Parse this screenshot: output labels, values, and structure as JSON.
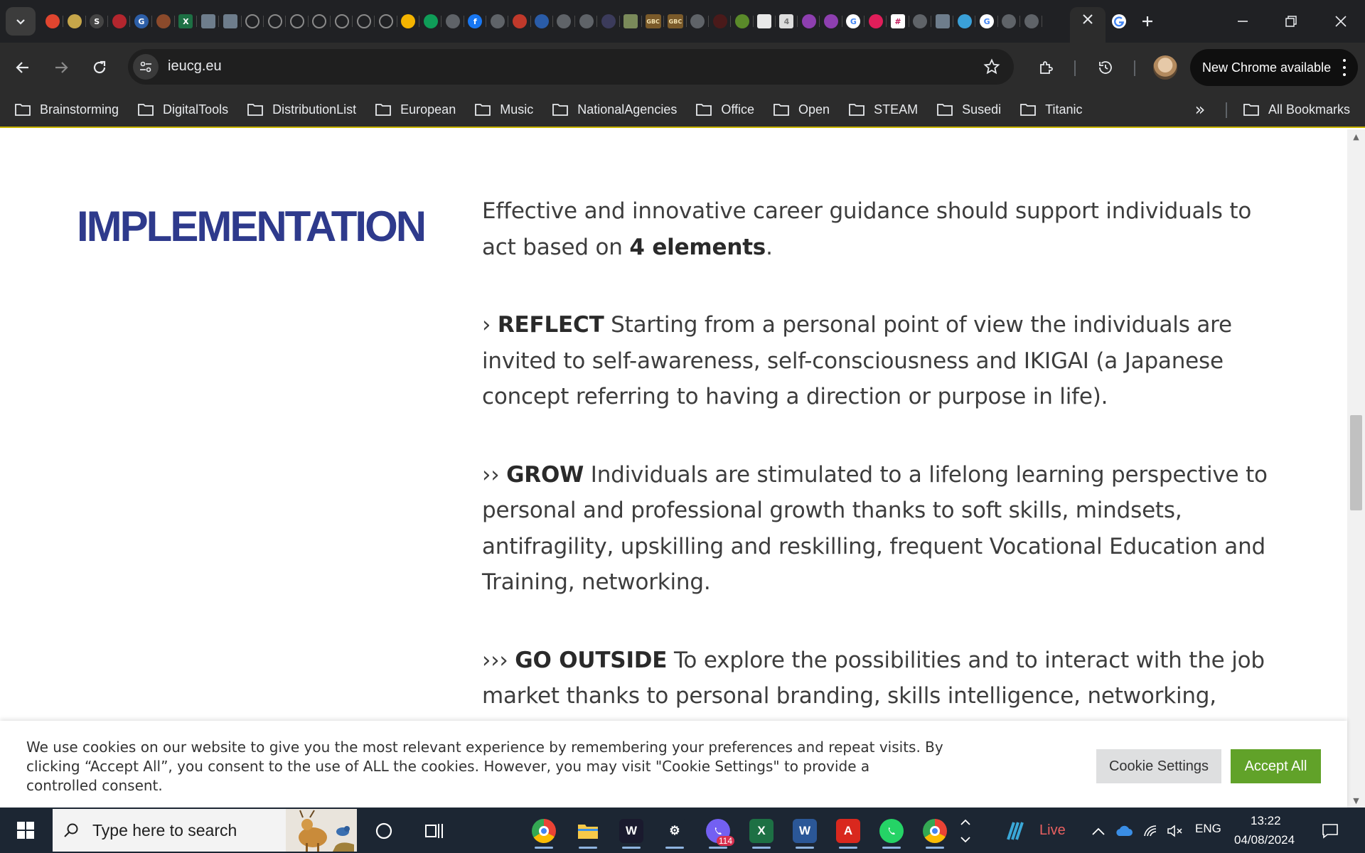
{
  "browser": {
    "active_tab_favicon": "google-icon",
    "url": "ieucg.eu",
    "update_label": "New Chrome available",
    "colors": {
      "tabstrip": "#202124",
      "toolbar": "#2c2c2c",
      "accent_border": "#c8b400"
    }
  },
  "tabs": [
    {
      "icon": "tab-favicon-red-circle",
      "color": "#e0452f",
      "glyph": ""
    },
    {
      "icon": "tab-favicon-colorful",
      "color": "#c6a64a",
      "glyph": ""
    },
    {
      "icon": "tab-favicon-s",
      "color": "#444444",
      "glyph": "S"
    },
    {
      "icon": "tab-favicon-red-logo",
      "color": "#b3262e",
      "glyph": ""
    },
    {
      "icon": "tab-favicon-g-blue",
      "color": "#2d5fa8",
      "glyph": "G"
    },
    {
      "icon": "tab-favicon-brown",
      "color": "#8b4a2b",
      "glyph": ""
    },
    {
      "icon": "tab-favicon-excel",
      "color": "#1d7044",
      "glyph": "X"
    },
    {
      "icon": "tab-favicon-photo",
      "color": "#6e7d8c",
      "glyph": ""
    },
    {
      "icon": "tab-favicon-photo",
      "color": "#6e7d8c",
      "glyph": ""
    },
    {
      "icon": "tab-favicon-loading",
      "color": "",
      "glyph": ""
    },
    {
      "icon": "tab-favicon-loading",
      "color": "",
      "glyph": ""
    },
    {
      "icon": "tab-favicon-loading",
      "color": "",
      "glyph": ""
    },
    {
      "icon": "tab-favicon-loading",
      "color": "",
      "glyph": ""
    },
    {
      "icon": "tab-favicon-loading",
      "color": "",
      "glyph": ""
    },
    {
      "icon": "tab-favicon-loading",
      "color": "",
      "glyph": ""
    },
    {
      "icon": "tab-favicon-loading",
      "color": "",
      "glyph": ""
    },
    {
      "icon": "tab-favicon-drive",
      "color": "#f4b400",
      "glyph": ""
    },
    {
      "icon": "tab-favicon-drive",
      "color": "#0f9d58",
      "glyph": ""
    },
    {
      "icon": "tab-favicon-globe",
      "color": "#5f6368",
      "glyph": ""
    },
    {
      "icon": "tab-favicon-facebook",
      "color": "#1877f2",
      "glyph": "f"
    },
    {
      "icon": "tab-favicon-globe",
      "color": "#5f6368",
      "glyph": ""
    },
    {
      "icon": "tab-favicon-red-white",
      "color": "#c0392b",
      "glyph": ""
    },
    {
      "icon": "tab-favicon-blue-circle",
      "color": "#2a5ca8",
      "glyph": ""
    },
    {
      "icon": "tab-favicon-globe",
      "color": "#5f6368",
      "glyph": ""
    },
    {
      "icon": "tab-favicon-globe",
      "color": "#5f6368",
      "glyph": ""
    },
    {
      "icon": "tab-favicon-dark",
      "color": "#3b3b5b",
      "glyph": ""
    },
    {
      "icon": "tab-favicon-photo",
      "color": "#7a8a5a",
      "glyph": ""
    },
    {
      "icon": "tab-favicon-gbc",
      "color": "#7a5a2a",
      "glyph": "GBC"
    },
    {
      "icon": "tab-favicon-gbc",
      "color": "#7a5a2a",
      "glyph": "GBC"
    },
    {
      "icon": "tab-favicon-globe",
      "color": "#5f6368",
      "glyph": ""
    },
    {
      "icon": "tab-favicon-dark-red",
      "color": "#4a1a1a",
      "glyph": ""
    },
    {
      "icon": "tab-favicon-green-leaf",
      "color": "#5a8a2a",
      "glyph": ""
    },
    {
      "icon": "tab-favicon-doc",
      "color": "#e8e8e8",
      "glyph": ""
    },
    {
      "icon": "tab-favicon-four",
      "color": "#dddddd",
      "glyph": "4"
    },
    {
      "icon": "tab-favicon-pink-star",
      "color": "#8e3fb0",
      "glyph": ""
    },
    {
      "icon": "tab-favicon-pink-star",
      "color": "#8e3fb0",
      "glyph": ""
    },
    {
      "icon": "tab-favicon-google",
      "color": "#ffffff",
      "glyph": "G"
    },
    {
      "icon": "tab-favicon-slack",
      "color": "#e01e5a",
      "glyph": ""
    },
    {
      "icon": "tab-favicon-hash",
      "color": "#ffffff",
      "glyph": "#"
    },
    {
      "icon": "tab-favicon-globe",
      "color": "#5f6368",
      "glyph": ""
    },
    {
      "icon": "tab-favicon-photo",
      "color": "#6e7d8c",
      "glyph": ""
    },
    {
      "icon": "tab-favicon-shield",
      "color": "#3aa0d8",
      "glyph": ""
    },
    {
      "icon": "tab-favicon-google",
      "color": "#ffffff",
      "glyph": "G"
    },
    {
      "icon": "tab-favicon-globe",
      "color": "#5f6368",
      "glyph": ""
    },
    {
      "icon": "tab-favicon-globe",
      "color": "#5f6368",
      "glyph": ""
    }
  ],
  "bookmarks": [
    "Brainstorming",
    "DigitalTools",
    "DistributionList",
    "European",
    "Music",
    "NationalAgencies",
    "Office",
    "Open",
    "STEAM",
    "Susedi",
    "Titanic"
  ],
  "all_bookmarks_label": "All Bookmarks",
  "page": {
    "section_title": "IMPLEMENTATION",
    "intro_pre": "Effective and innovative career guidance should support individuals to act based on ",
    "intro_bold": "4 elements",
    "intro_post": ".",
    "items": [
      {
        "marker": "› ",
        "title": "REFLECT",
        "text": " Starting from a personal point of view the individuals are invited to self-awareness, self-consciousness and IKIGAI (a Japanese concept referring to having a direction or purpose in life)."
      },
      {
        "marker": "›› ",
        "title": "GROW",
        "text": " Individuals are stimulated to a lifelong learning perspective to personal and professional growth thanks to soft skills, mindsets, antifragility, upskilling and reskilling, frequent Vocational Education and Training, networking."
      },
      {
        "marker": "››› ",
        "title": "GO OUTSIDE",
        "text": " To explore the possibilities and to interact with the job market thanks to personal branding, skills intelligence, networking,"
      }
    ],
    "colors": {
      "title": "#2e3a8c",
      "body": "#3d3d3d"
    }
  },
  "cookie_banner": {
    "text": "We use cookies on our website to give you the most relevant experience by remembering your preferences and repeat visits. By clicking “Accept All”, you consent to the use of ALL the cookies. However, you may visit \"Cookie Settings\" to provide a controlled consent.",
    "settings_label": "Cookie Settings",
    "accept_label": "Accept All",
    "colors": {
      "accept": "#61a229",
      "settings": "#dedfe0"
    }
  },
  "taskbar": {
    "search_placeholder": "Type here to search",
    "apps": [
      {
        "name": "chrome-app",
        "color": "#ea4335",
        "glyph": ""
      },
      {
        "name": "file-explorer-app",
        "color": "#f0b429",
        "glyph": ""
      },
      {
        "name": "webex-app",
        "color": "#1a1a2e",
        "glyph": "W"
      },
      {
        "name": "settings-app",
        "color": "#1c2633",
        "glyph": "⚙"
      },
      {
        "name": "viber-app",
        "color": "#7360f2",
        "glyph": ""
      },
      {
        "name": "excel-app",
        "color": "#1d7044",
        "glyph": "X"
      },
      {
        "name": "word-app",
        "color": "#2b5797",
        "glyph": "W"
      },
      {
        "name": "acrobat-app",
        "color": "#d9281e",
        "glyph": "A"
      },
      {
        "name": "whatsapp-app",
        "color": "#25d366",
        "glyph": ""
      },
      {
        "name": "chrome-profile-app",
        "color": "#ea4335",
        "glyph": ""
      }
    ],
    "viber_badge": "114",
    "live_label": "Live",
    "language": "ENG",
    "time": "13:22",
    "date": "04/08/2024"
  }
}
